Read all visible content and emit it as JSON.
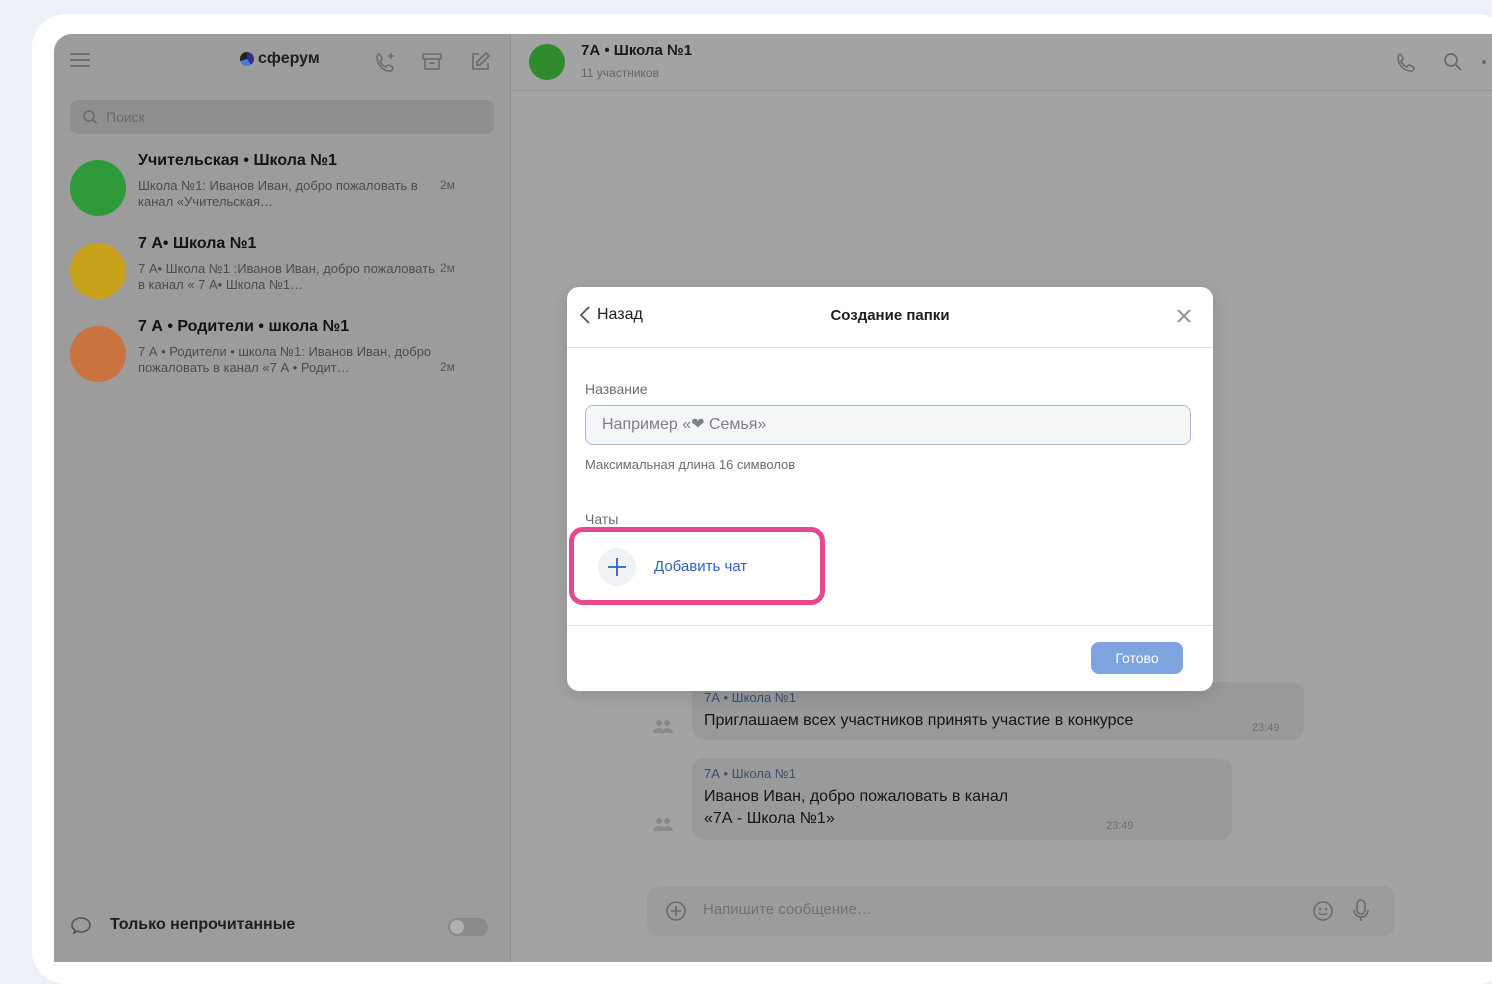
{
  "sidebar": {
    "brand": "сферум",
    "search_placeholder": "Поиск",
    "chats": [
      {
        "name": "Учительская • Школа №1",
        "preview": "Школа №1: Иванов Иван, добро пожаловать в канал «Учительская…",
        "time": "2м",
        "avatar_color": "#2f9a3a"
      },
      {
        "name": "7 А• Школа №1",
        "preview": "7 А• Школа №1 :Иванов Иван, добро пожаловать в канал « 7 А• Школа №1…",
        "time": "2м",
        "avatar_color": "#c9a21b"
      },
      {
        "name": "7 А • Родители • школа №1",
        "preview": "7 А • Родители • школа №1: Иванов Иван, добро пожаловать в канал «7 А • Родит…",
        "time": "2м",
        "avatar_color": "#c9733e"
      }
    ],
    "unread_only_label": "Только непрочитанные"
  },
  "chat": {
    "title": "7А • Школа №1",
    "subtitle": "11 участников",
    "messages": [
      {
        "author": "7А • Школа №1",
        "text": "Приглашаем всех  участников принять участие в конкурсе",
        "time": "23:49"
      },
      {
        "author": "7А • Школа №1",
        "text_line1": "Иванов Иван, добро пожаловать в канал",
        "text_line2": "«7А - Школа №1»",
        "time": "23:49"
      }
    ],
    "composer_placeholder": "Напишите сообщение…"
  },
  "modal": {
    "back_label": "Назад",
    "title": "Создание папки",
    "name_label": "Название",
    "name_placeholder": "Например «❤ Семья»",
    "name_hint": "Максимальная длина 16 символов",
    "chats_label": "Чаты",
    "add_chat_label": "Добавить чат",
    "done_label": "Готово"
  },
  "colors": {
    "highlight": "#e6478f",
    "accent": "#2c62c5",
    "done_button": "#7ea4e0"
  }
}
